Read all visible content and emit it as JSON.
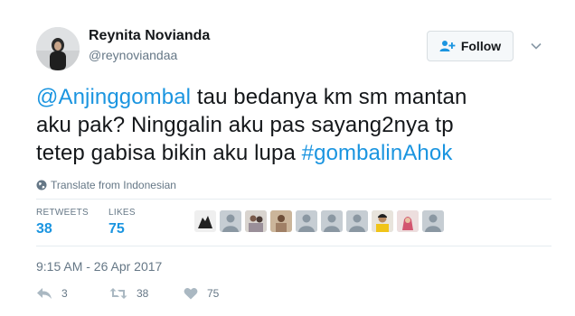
{
  "user": {
    "name": "Reynita Novianda",
    "handle": "@reynoviandaa"
  },
  "follow_button": {
    "label": "Follow"
  },
  "tweet": {
    "mention": "@Anjinggombal",
    "text_line1": " tau bedanya km sm mantan",
    "text_line2": "aku pak? Ninggalin aku pas sayang2nya tp",
    "text_line3": "tetep gabisa bikin aku lupa ",
    "hashtag": "#gombalinAhok"
  },
  "translate": {
    "label": "Translate from Indonesian"
  },
  "stats": {
    "retweets_label": "RETWEETS",
    "retweets_value": "38",
    "likes_label": "LIKES",
    "likes_value": "75"
  },
  "likers": [
    "liker-avatar",
    "liker-avatar",
    "liker-avatar",
    "liker-avatar",
    "liker-avatar",
    "liker-avatar",
    "liker-avatar",
    "liker-avatar",
    "liker-avatar",
    "liker-avatar"
  ],
  "timestamp": "9:15 AM - 26 Apr 2017",
  "actions": {
    "reply_count": "3",
    "retweet_count": "38",
    "like_count": "75"
  },
  "colors": {
    "link": "#1b95e0",
    "muted": "#657786",
    "divider": "#e6ecf0"
  }
}
